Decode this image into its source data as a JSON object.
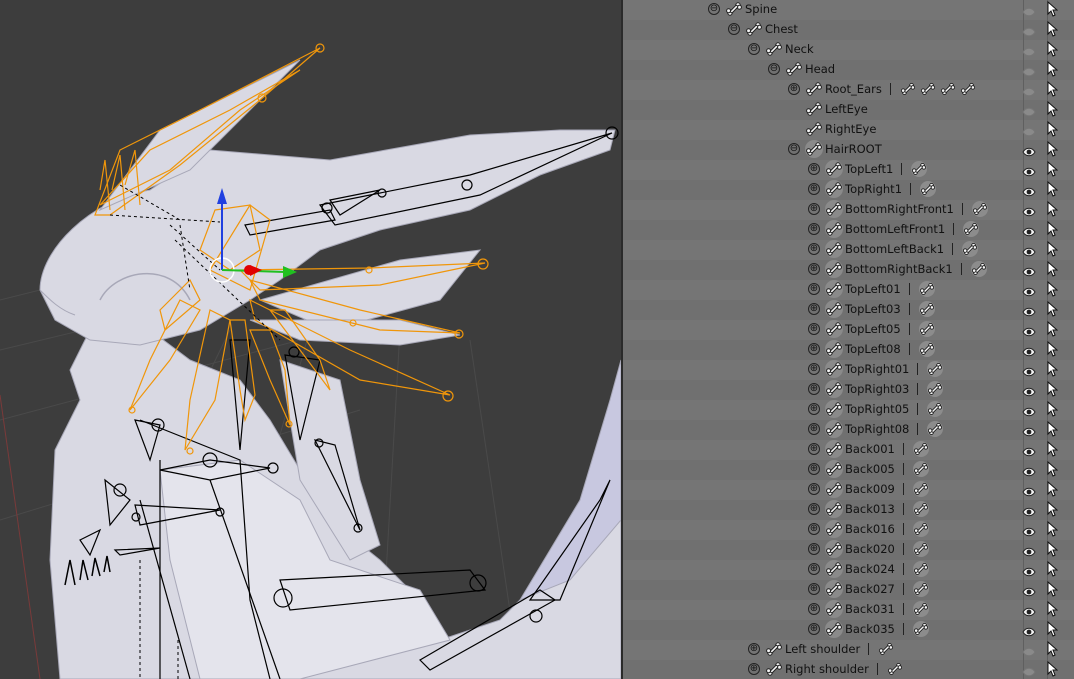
{
  "outliner": {
    "rows": [
      {
        "label": "Spine",
        "depth": 0,
        "expander": "⊖",
        "round": false,
        "children": 0,
        "eye": "dim"
      },
      {
        "label": "Chest",
        "depth": 1,
        "expander": "⊖",
        "round": false,
        "children": 0,
        "eye": "dim"
      },
      {
        "label": "Neck",
        "depth": 2,
        "expander": "⊖",
        "round": false,
        "children": 0,
        "eye": "dim"
      },
      {
        "label": "Head",
        "depth": 3,
        "expander": "⊖",
        "round": false,
        "children": 0,
        "eye": "dim"
      },
      {
        "label": "Root_Ears",
        "depth": 4,
        "expander": "⊕",
        "round": false,
        "children": 4,
        "eye": "dim"
      },
      {
        "label": "LeftEye",
        "depth": 4,
        "expander": "",
        "round": false,
        "children": 0,
        "eye": "dim"
      },
      {
        "label": "RightEye",
        "depth": 4,
        "expander": "",
        "round": false,
        "children": 0,
        "eye": "dim"
      },
      {
        "label": "HairROOT",
        "depth": 4,
        "expander": "⊖",
        "round": true,
        "children": 0,
        "eye": "on"
      },
      {
        "label": "TopLeft1",
        "depth": 5,
        "expander": "⊕",
        "round": true,
        "children": 1,
        "eye": "on"
      },
      {
        "label": "TopRight1",
        "depth": 5,
        "expander": "⊕",
        "round": true,
        "children": 1,
        "eye": "on"
      },
      {
        "label": "BottomRightFront1",
        "depth": 5,
        "expander": "⊕",
        "round": true,
        "children": 1,
        "eye": "on"
      },
      {
        "label": "BottomLeftFront1",
        "depth": 5,
        "expander": "⊕",
        "round": true,
        "children": 1,
        "eye": "on"
      },
      {
        "label": "BottomLeftBack1",
        "depth": 5,
        "expander": "⊕",
        "round": true,
        "children": 1,
        "eye": "on"
      },
      {
        "label": "BottomRightBack1",
        "depth": 5,
        "expander": "⊕",
        "round": true,
        "children": 1,
        "eye": "on"
      },
      {
        "label": "TopLeft01",
        "depth": 5,
        "expander": "⊕",
        "round": true,
        "children": 1,
        "eye": "on"
      },
      {
        "label": "TopLeft03",
        "depth": 5,
        "expander": "⊕",
        "round": true,
        "children": 1,
        "eye": "on"
      },
      {
        "label": "TopLeft05",
        "depth": 5,
        "expander": "⊕",
        "round": true,
        "children": 1,
        "eye": "on"
      },
      {
        "label": "TopLeft08",
        "depth": 5,
        "expander": "⊕",
        "round": true,
        "children": 1,
        "eye": "on"
      },
      {
        "label": "TopRight01",
        "depth": 5,
        "expander": "⊕",
        "round": true,
        "children": 1,
        "eye": "on"
      },
      {
        "label": "TopRight03",
        "depth": 5,
        "expander": "⊕",
        "round": true,
        "children": 1,
        "eye": "on"
      },
      {
        "label": "TopRight05",
        "depth": 5,
        "expander": "⊕",
        "round": true,
        "children": 1,
        "eye": "on"
      },
      {
        "label": "TopRight08",
        "depth": 5,
        "expander": "⊕",
        "round": true,
        "children": 1,
        "eye": "on"
      },
      {
        "label": "Back001",
        "depth": 5,
        "expander": "⊕",
        "round": true,
        "children": 1,
        "eye": "on"
      },
      {
        "label": "Back005",
        "depth": 5,
        "expander": "⊕",
        "round": true,
        "children": 1,
        "eye": "on"
      },
      {
        "label": "Back009",
        "depth": 5,
        "expander": "⊕",
        "round": true,
        "children": 1,
        "eye": "on"
      },
      {
        "label": "Back013",
        "depth": 5,
        "expander": "⊕",
        "round": true,
        "children": 1,
        "eye": "on"
      },
      {
        "label": "Back016",
        "depth": 5,
        "expander": "⊕",
        "round": true,
        "children": 1,
        "eye": "on"
      },
      {
        "label": "Back020",
        "depth": 5,
        "expander": "⊕",
        "round": true,
        "children": 1,
        "eye": "on"
      },
      {
        "label": "Back024",
        "depth": 5,
        "expander": "⊕",
        "round": true,
        "children": 1,
        "eye": "on"
      },
      {
        "label": "Back027",
        "depth": 5,
        "expander": "⊕",
        "round": true,
        "children": 1,
        "eye": "on"
      },
      {
        "label": "Back031",
        "depth": 5,
        "expander": "⊕",
        "round": true,
        "children": 1,
        "eye": "on"
      },
      {
        "label": "Back035",
        "depth": 5,
        "expander": "⊕",
        "round": true,
        "children": 1,
        "eye": "on"
      },
      {
        "label": "Left shoulder",
        "depth": 2,
        "expander": "⊕",
        "round": false,
        "children": 1,
        "eye": "dim"
      },
      {
        "label": "Right shoulder",
        "depth": 2,
        "expander": "⊕",
        "round": false,
        "children": 1,
        "eye": "dim"
      }
    ]
  },
  "colors": {
    "bone_selected": "#f0960a",
    "bone_default": "#000000",
    "mesh": "#dcdce6",
    "viewport_bg": "#3d3d3d",
    "axis_x": "#e00000",
    "axis_y": "#20c020",
    "axis_z": "#2040e0"
  },
  "icons": {
    "bone": "bone-icon",
    "child_bone": "child-bone-icon",
    "eye": "eye-icon",
    "select": "cursor-arrow-icon"
  }
}
